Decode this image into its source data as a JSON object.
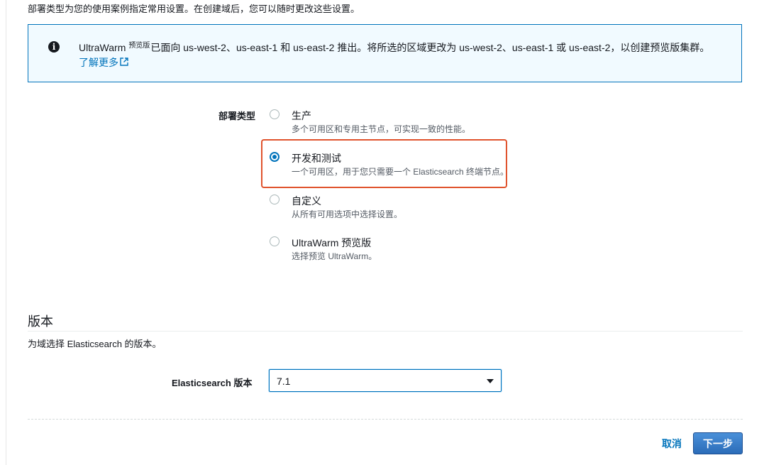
{
  "intro_text": "部署类型为您的使用案例指定常用设置。在创建域后，您可以随时更改这些设置。",
  "info_alert": {
    "icon": "info-icon",
    "product": "UltraWarm",
    "preview_badge": "预览版",
    "message": "已面向 us-west-2、us-east-1 和 us-east-2 推出。将所选的区域更改为 us-west-2、us-east-1 或 us-east-2，以创建预览版集群。",
    "learn_more": "了解更多",
    "external_icon": "external-link-icon",
    "accent_color": "#0073bb"
  },
  "deployment_type": {
    "label": "部署类型",
    "selected_index": 1,
    "options": [
      {
        "title": "生产",
        "description": "多个可用区和专用主节点，可实现一致的性能。",
        "checked": false
      },
      {
        "title": "开发和测试",
        "description": "一个可用区，用于您只需要一个 Elasticsearch 终端节点。",
        "checked": true
      },
      {
        "title": "自定义",
        "description": "从所有可用选项中选择设置。",
        "checked": false
      },
      {
        "title": "UltraWarm 预览版",
        "description": "选择预览 UltraWarm。",
        "checked": false
      }
    ],
    "highlight_color": "#e0532d"
  },
  "version_section": {
    "title": "版本",
    "description": "为域选择 Elasticsearch 的版本。",
    "field_label": "Elasticsearch 版本",
    "selected_value": "7.1"
  },
  "footer": {
    "cancel_label": "取消",
    "next_label": "下一步",
    "primary_color": "#2b6cb8"
  }
}
